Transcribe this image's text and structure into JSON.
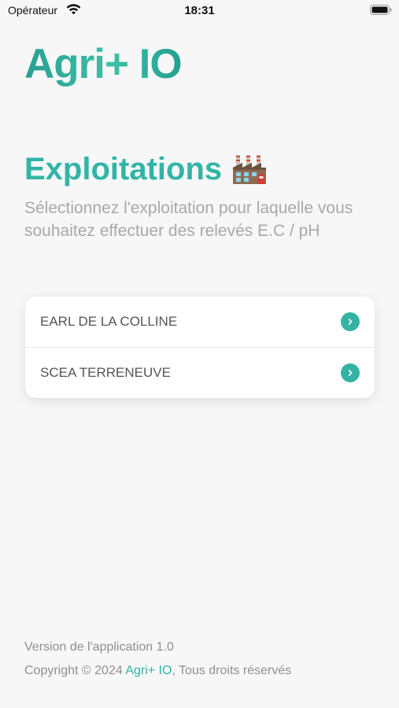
{
  "status_bar": {
    "carrier": "Opérateur",
    "time": "18:31",
    "icons": [
      "wifi-icon",
      "battery-icon"
    ]
  },
  "brand": {
    "name": "Agri+ IO",
    "gradient": [
      "#2a9f91",
      "#3cc0a8",
      "#22a091"
    ]
  },
  "page": {
    "title": "Exploitations",
    "title_icon": "factory-icon",
    "subtitle": "Sélectionnez l'exploitation pour laquelle vous souhaitez effectuer des relevés E.C / pH"
  },
  "farms": [
    {
      "label": "EARL DE LA COLLINE",
      "icon": "chevron-right-icon"
    },
    {
      "label": "SCEA TERRENEUVE",
      "icon": "chevron-right-icon"
    }
  ],
  "footer": {
    "version": "Version de l'application 1.0",
    "copyright_prefix": "Copyright © 2024 ",
    "copyright_brand": "Agri+ IO",
    "copyright_suffix": ", Tous droits réservés"
  },
  "colors": {
    "accent": "#34b3a4",
    "background": "#f7f7f7",
    "muted_text": "#a8a8a8"
  }
}
